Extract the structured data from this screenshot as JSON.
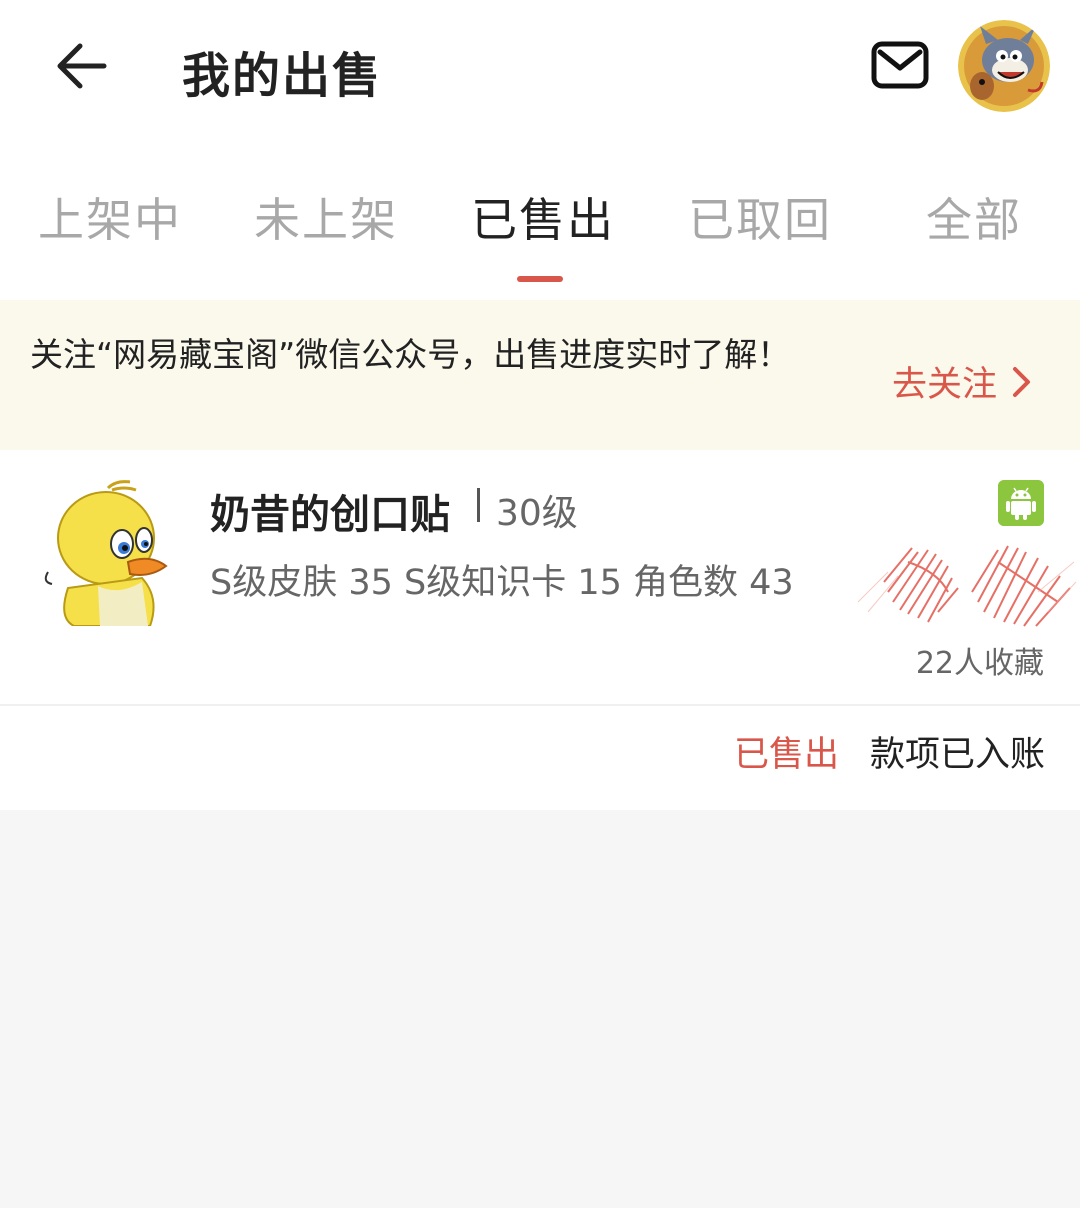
{
  "header": {
    "title": "我的出售"
  },
  "tabs": [
    {
      "label": "上架中",
      "active": false
    },
    {
      "label": "未上架",
      "active": false
    },
    {
      "label": "已售出",
      "active": true
    },
    {
      "label": "已取回",
      "active": false
    },
    {
      "label": "全部",
      "active": false
    }
  ],
  "notice": {
    "text": "关注“网易藏宝阁”微信公众号，出售进度实时了解！",
    "action_label": "去关注"
  },
  "listing": {
    "name": "奶昔的创口贴",
    "level": "30级",
    "stats": "S级皮肤 35 S级知识卡 15 角色数 43",
    "platform_icon": "android-icon",
    "favorites": "22人收藏",
    "status": "已售出",
    "payment_status": "款项已入账"
  },
  "colors": {
    "accent": "#d9574a",
    "notice_bg": "#fbf8ec",
    "android_green": "#8cc63e"
  }
}
